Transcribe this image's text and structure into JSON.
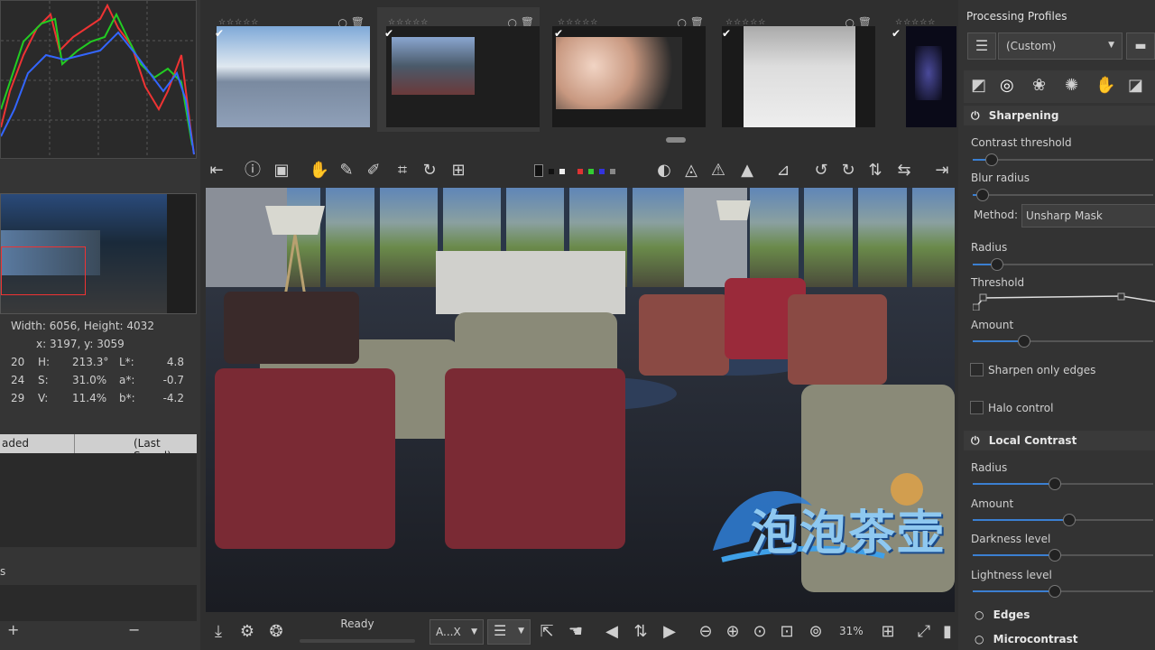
{
  "left": {
    "image_size": "Width: 6056, Height: 4032",
    "cursor": "x: 3197, y: 3059",
    "readouts": [
      {
        "a": "20",
        "k": "H:",
        "v": "213.3°",
        "k2": "L*:",
        "v2": "4.8"
      },
      {
        "a": "24",
        "k": "S:",
        "v": "31.0%",
        "k2": "a*:",
        "v2": "-0.7"
      },
      {
        "a": "29",
        "k": "V:",
        "v": "11.4%",
        "k2": "b*:",
        "v2": "-4.2"
      }
    ],
    "history_col1": "aded",
    "history_col2": "(Last Saved)",
    "snapshots_label": "s",
    "plus": "+",
    "minus": "−"
  },
  "film": {
    "stars": "☆☆☆☆☆"
  },
  "bottom": {
    "status": "Ready",
    "select_label": "A...X",
    "zoom": "31%"
  },
  "right": {
    "title": "Processing Profiles",
    "profile": "(Custom)",
    "sharpening": {
      "title": "Sharpening",
      "contrast_threshold": "Contrast threshold",
      "contrast_threshold_pct": 10,
      "blur_radius": "Blur radius",
      "blur_radius_pct": 5,
      "method_label": "Method:",
      "method_value": "Unsharp Mask",
      "radius": "Radius",
      "radius_pct": 13,
      "threshold": "Threshold",
      "amount": "Amount",
      "amount_pct": 28,
      "edges_only": "Sharpen only edges",
      "halo": "Halo control"
    },
    "local_contrast": {
      "title": "Local Contrast",
      "radius": "Radius",
      "radius_pct": 45,
      "amount": "Amount",
      "amount_pct": 53,
      "darkness": "Darkness level",
      "darkness_pct": 45,
      "lightness": "Lightness level",
      "lightness_pct": 45
    },
    "edges": "Edges",
    "microcontrast": "Microcontrast"
  },
  "watermark": "泡泡茶壶"
}
